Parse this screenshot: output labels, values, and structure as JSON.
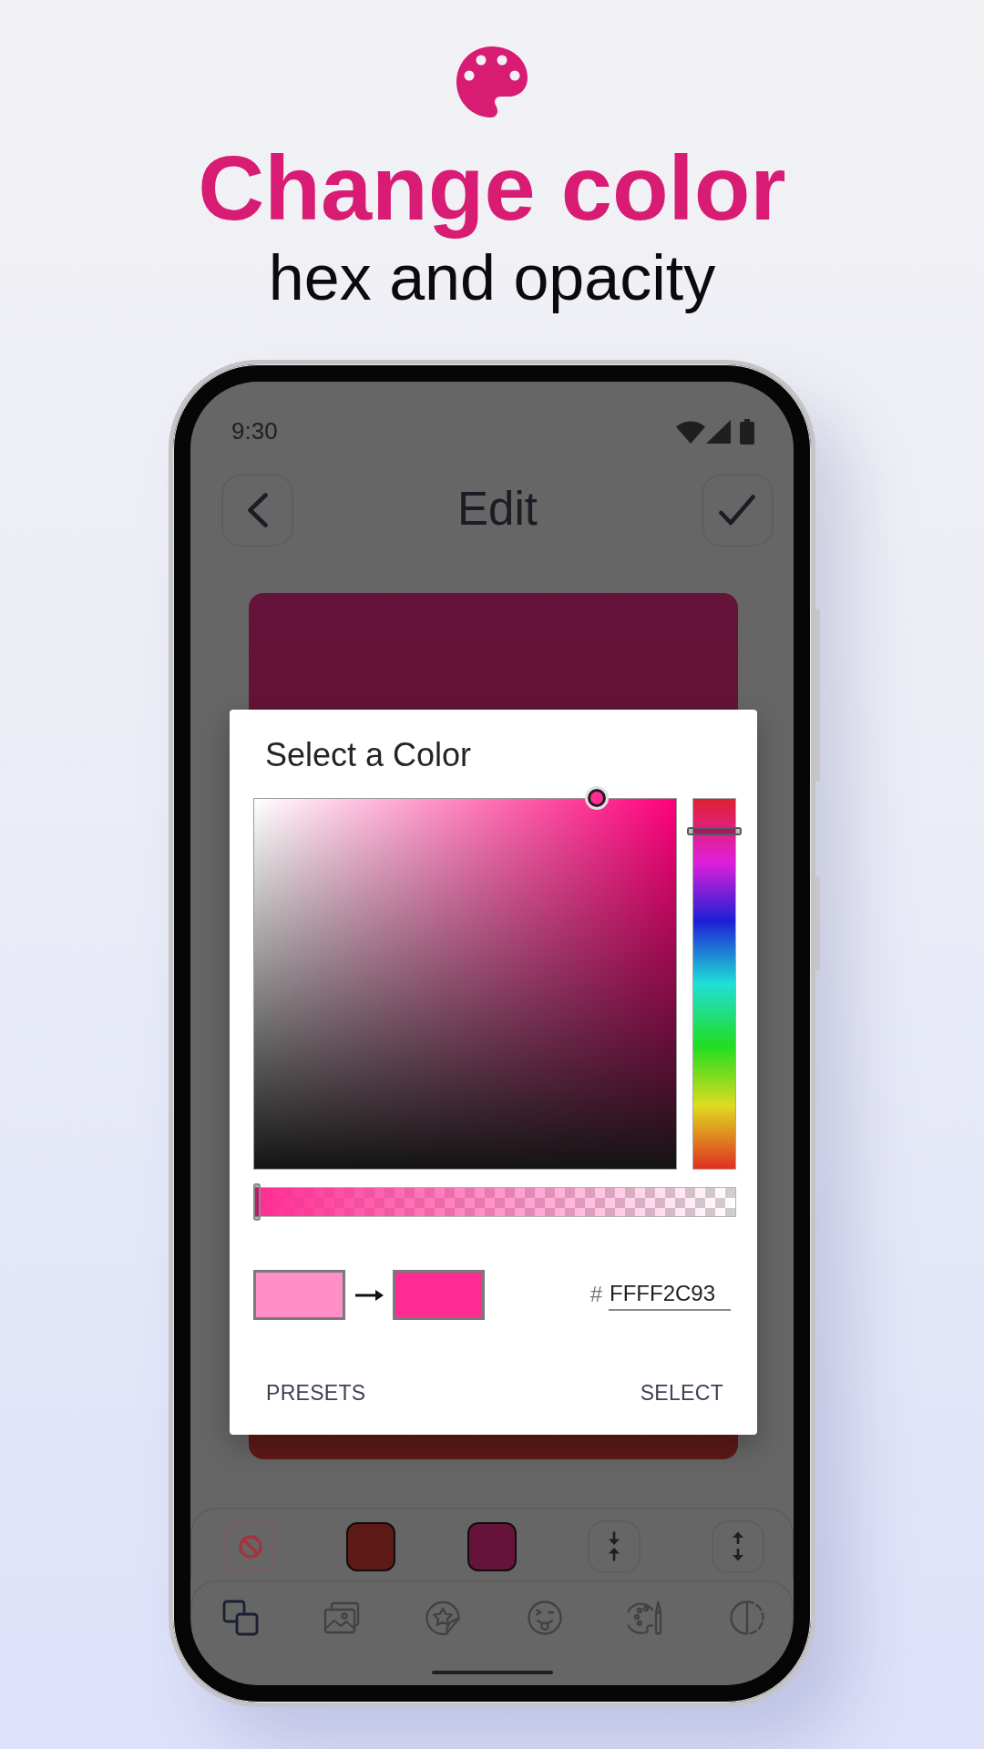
{
  "hero": {
    "title": "Change color",
    "subtitle": "hex and opacity"
  },
  "status_bar": {
    "time": "9:30"
  },
  "header": {
    "title": "Edit"
  },
  "dialog": {
    "title": "Select a Color",
    "color_field": {
      "level": 0.83
    },
    "hue_slider": {
      "level": 0.92
    },
    "alpha_slider": {
      "level": 0
    },
    "swatches": [
      {
        "color": "#ff8fc6"
      },
      {
        "color": "#ff2c93"
      }
    ],
    "hex_field": {
      "prefix": "#",
      "value": "FFFF2C93"
    },
    "buttons": [
      "PRESETS",
      "SELECT"
    ]
  },
  "color_bar": {
    "swatches": [
      {
        "color": "#5e1a17"
      },
      {
        "color": "#65133a"
      }
    ]
  },
  "tab_bar": {
    "tabs": [
      {
        "selected": true
      },
      {
        "selected": false
      },
      {
        "selected": false
      },
      {
        "selected": false
      },
      {
        "selected": false
      },
      {
        "selected": false
      }
    ]
  }
}
